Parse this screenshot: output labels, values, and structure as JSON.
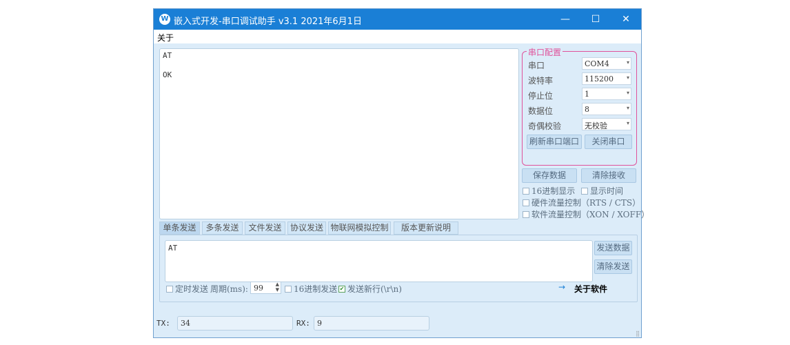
{
  "window": {
    "logo": "W",
    "title": "嵌入式开发-串口调试助手 v3.1 2021年6月1日",
    "min_icon": "—",
    "max_icon": "☐",
    "close_icon": "✕"
  },
  "menu": {
    "about": "关于"
  },
  "receive": {
    "lines": [
      "AT",
      "OK"
    ]
  },
  "config": {
    "legend": "串口配置",
    "rows": [
      {
        "label": "串口",
        "value": "COM4"
      },
      {
        "label": "波特率",
        "value": "115200"
      },
      {
        "label": "停止位",
        "value": "1"
      },
      {
        "label": "数据位",
        "value": "8"
      },
      {
        "label": "奇偶校验",
        "value": "无校验"
      }
    ],
    "refresh_btn": "刷新串口端口",
    "close_btn": "关闭串口"
  },
  "actions": {
    "save": "保存数据",
    "clear_recv": "清除接收"
  },
  "options": {
    "hex_display": {
      "label": "16进制显示",
      "checked": false
    },
    "show_time": {
      "label": "显示时间",
      "checked": false
    },
    "hw_flow": {
      "label": "硬件流量控制（RTS / CTS）",
      "checked": false
    },
    "sw_flow": {
      "label": "软件流量控制（XON / XOFF）",
      "checked": false
    }
  },
  "tabs": [
    "单条发送",
    "多条发送",
    "文件发送",
    "协议发送",
    "物联网模拟控制",
    "版本更新说明"
  ],
  "send": {
    "text": "AT",
    "send_btn": "发送数据",
    "clear_btn": "清除发送",
    "timed_send": {
      "label": "定时发送",
      "checked": false
    },
    "period_label": "周期(ms):",
    "period_value": "99",
    "hex_send": {
      "label": "16进制发送",
      "checked": false
    },
    "newline": {
      "label": "发送新行(\\r\\n)",
      "checked": true
    },
    "arrow": "→",
    "about_link": "关于软件"
  },
  "status": {
    "tx_label": "TX:",
    "tx_value": "34",
    "rx_label": "RX:",
    "rx_value": "9"
  },
  "colors": {
    "titlebar": "#1a7fd6",
    "config_border": "#e0519a",
    "background": "#dcecf9"
  }
}
